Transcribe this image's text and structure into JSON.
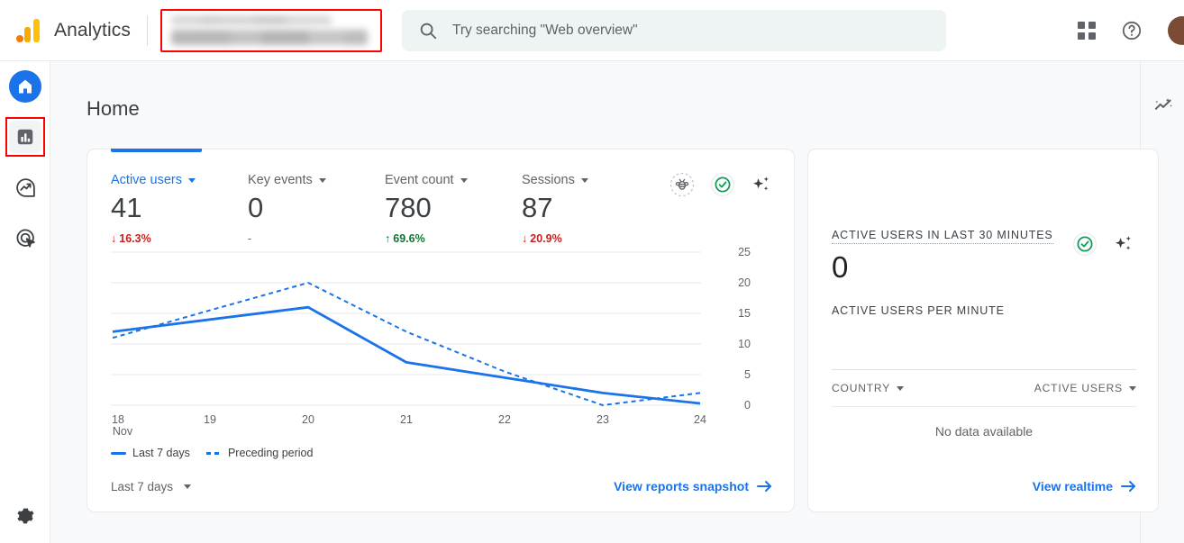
{
  "topbar": {
    "brand": "Analytics",
    "property_selector_label": "",
    "search_placeholder": "Try searching \"Web overview\"",
    "icons": [
      "search-icon",
      "apps-grid-icon",
      "help-icon",
      "avatar"
    ]
  },
  "sidebar": {
    "items": [
      {
        "name": "home",
        "label": "Home",
        "active": true
      },
      {
        "name": "reports",
        "label": "Reports",
        "highlighted": true
      },
      {
        "name": "explore",
        "label": "Explore"
      },
      {
        "name": "advertising",
        "label": "Advertising"
      }
    ],
    "footer": {
      "name": "admin",
      "label": "Admin"
    }
  },
  "page": {
    "title": "Home"
  },
  "main_card": {
    "metrics": [
      {
        "label": "Active users",
        "value": "41",
        "delta": "16.3%",
        "direction": "down",
        "active": true
      },
      {
        "label": "Key events",
        "value": "0",
        "delta": "-",
        "direction": "none",
        "active": false
      },
      {
        "label": "Event count",
        "value": "780",
        "delta": "69.6%",
        "direction": "up",
        "active": false
      },
      {
        "label": "Sessions",
        "value": "87",
        "delta": "20.9%",
        "direction": "down",
        "active": false
      }
    ],
    "icons": [
      "bee-icon",
      "check-circle-icon",
      "sparkle-icon"
    ],
    "legend": [
      {
        "label": "Last 7 days",
        "style": "solid"
      },
      {
        "label": "Preceding period",
        "style": "dashed"
      }
    ],
    "date_range": "Last 7 days",
    "footer_link": "View reports snapshot"
  },
  "realtime_card": {
    "headline": "ACTIVE USERS IN LAST 30 MINUTES",
    "value": "0",
    "subhead": "ACTIVE USERS PER MINUTE",
    "icons": [
      "check-circle-icon",
      "sparkle-icon"
    ],
    "table": {
      "columns": [
        "COUNTRY",
        "ACTIVE USERS"
      ],
      "empty_message": "No data available"
    },
    "footer_link": "View realtime"
  },
  "colors": {
    "accent_blue": "#1a73e8",
    "negative_red": "#c5221f",
    "positive_green": "#137333",
    "highlight_red": "#ff0000",
    "page_bg": "#f8f9fa"
  },
  "chart_data": {
    "type": "line",
    "title": "",
    "xlabel": "",
    "ylabel": "",
    "x": [
      "18",
      "19",
      "20",
      "21",
      "22",
      "23",
      "24"
    ],
    "x_axis_unit": "Nov",
    "yticks": [
      0,
      5,
      10,
      15,
      20,
      25
    ],
    "ylim": [
      0,
      25
    ],
    "grid": true,
    "legend_position": "bottom-left",
    "series": [
      {
        "name": "Last 7 days",
        "style": "solid",
        "color": "#1a73e8",
        "values": [
          12,
          14,
          16,
          7,
          4.5,
          2,
          0.3
        ]
      },
      {
        "name": "Preceding period",
        "style": "dashed",
        "color": "#1a73e8",
        "values": [
          11,
          15.5,
          20,
          12,
          5.5,
          0,
          2
        ]
      }
    ]
  }
}
